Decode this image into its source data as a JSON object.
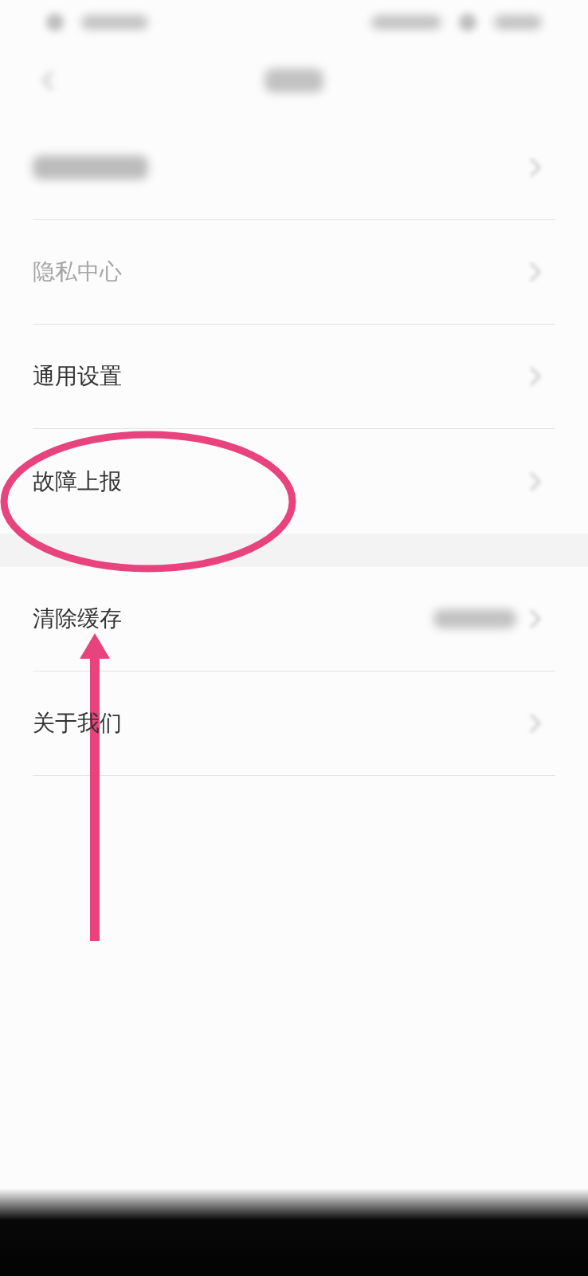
{
  "status_bar": {
    "blurred": true
  },
  "header": {
    "back_button": {
      "blurred": true
    },
    "title": {
      "blurred": true
    }
  },
  "sections": [
    {
      "items": [
        {
          "kind": "blurred",
          "chevron": true,
          "value_blurred": false
        },
        {
          "kind": "faded",
          "label": "隐私中心",
          "chevron": true,
          "value_blurred": false
        },
        {
          "kind": "plain",
          "label": "通用设置",
          "chevron": true,
          "value_blurred": false
        },
        {
          "kind": "plain",
          "label": "故障上报",
          "chevron": true,
          "value_blurred": false
        }
      ]
    },
    {
      "items": [
        {
          "kind": "plain",
          "label": "清除缓存",
          "chevron": true,
          "value_blurred": true
        },
        {
          "kind": "plain",
          "label": "关于我们",
          "chevron": true,
          "value_blurred": false
        }
      ]
    }
  ],
  "annotations": [
    {
      "kind": "ellipse"
    },
    {
      "kind": "arrow"
    }
  ],
  "navigation_bar": {
    "blurred": true
  }
}
